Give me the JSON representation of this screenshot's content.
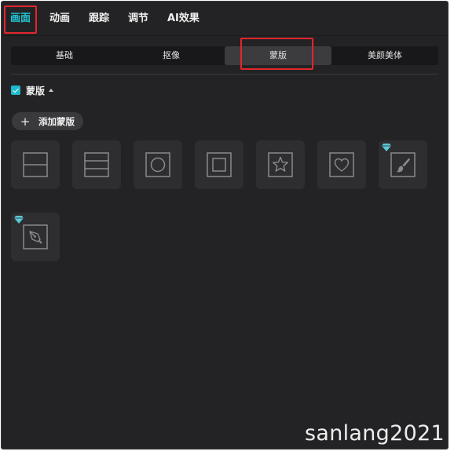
{
  "top_tabs": [
    "画面",
    "动画",
    "跟踪",
    "调节",
    "AI效果"
  ],
  "sub_tabs": [
    "基础",
    "抠像",
    "蒙版",
    "美颜美体"
  ],
  "mask": {
    "title": "蒙版",
    "enabled": true,
    "add_label": "添加蒙版"
  },
  "mask_tiles": [
    {
      "icon": "split-line-icon",
      "premium": false
    },
    {
      "icon": "mirror-icon",
      "premium": false
    },
    {
      "icon": "circle-icon",
      "premium": false
    },
    {
      "icon": "rectangle-icon",
      "premium": false
    },
    {
      "icon": "star-icon",
      "premium": false
    },
    {
      "icon": "heart-icon",
      "premium": false
    },
    {
      "icon": "brush-icon",
      "premium": true
    },
    {
      "icon": "pen-icon",
      "premium": true
    }
  ],
  "colors": {
    "accent": "#22c6d8",
    "highlight_box": "#e3262d",
    "panel_bg": "#232325",
    "premium_gem": "#5bc8d6"
  },
  "watermark": "sanlang2021"
}
